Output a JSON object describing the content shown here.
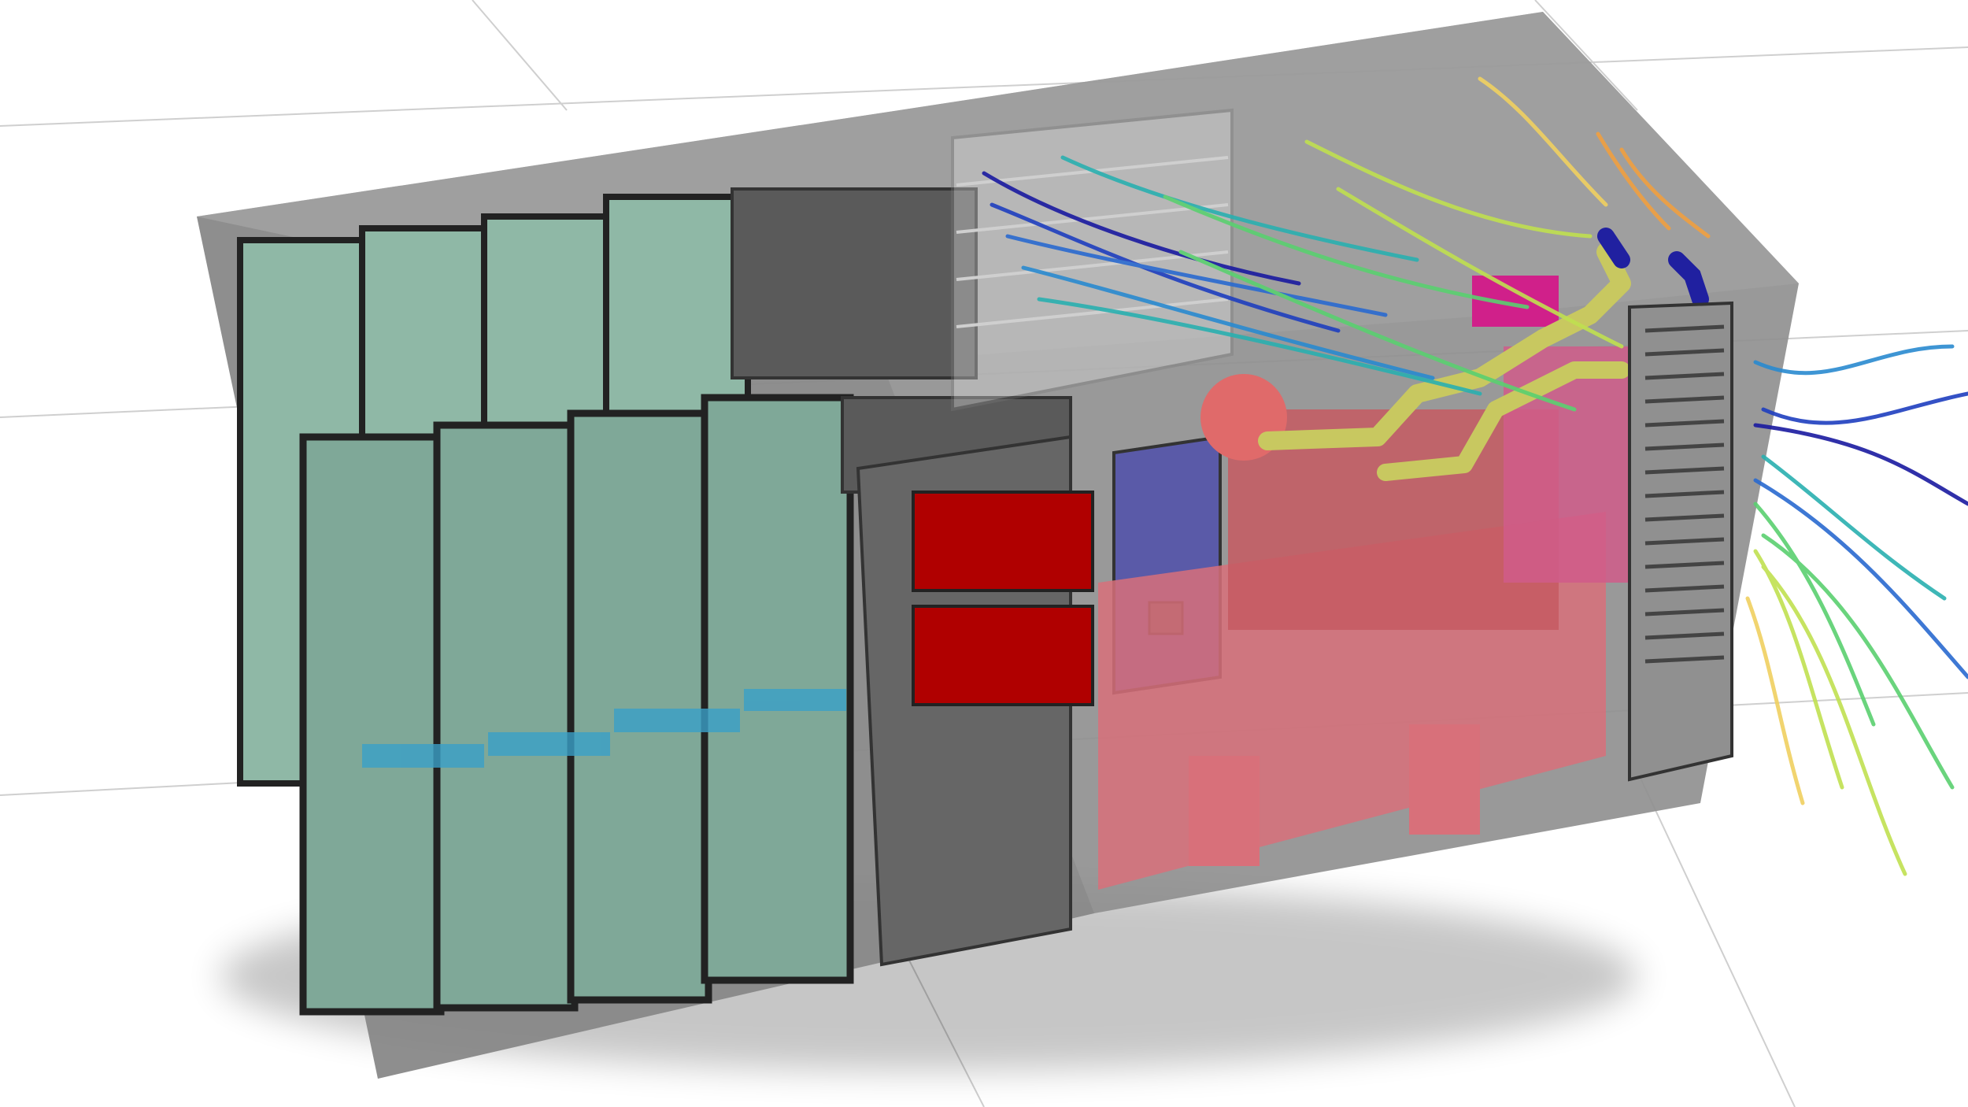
{
  "scene": {
    "components": [
      {
        "name": "container-enclosure",
        "color": "#808080"
      },
      {
        "name": "battery-rack-row-back",
        "count": 4,
        "color": "#8fb8a6"
      },
      {
        "name": "battery-rack-row-front",
        "count": 4,
        "color": "#8fb8a6"
      },
      {
        "name": "electrical-cabinet",
        "color": "#666666"
      },
      {
        "name": "control-panel",
        "color": "#b01010"
      },
      {
        "name": "blue-panel",
        "color": "#5a5aa8"
      },
      {
        "name": "generator-engine",
        "color": "#d8707a"
      },
      {
        "name": "exhaust-pipe",
        "color": "#c8c860"
      },
      {
        "name": "radiator",
        "color": "#909090"
      }
    ],
    "streamline_palette": [
      "#1a1aa0",
      "#2a6ad0",
      "#2ab0b0",
      "#5ad070",
      "#c0e050",
      "#f0d060",
      "#f0a040"
    ],
    "floor_grid": true
  }
}
